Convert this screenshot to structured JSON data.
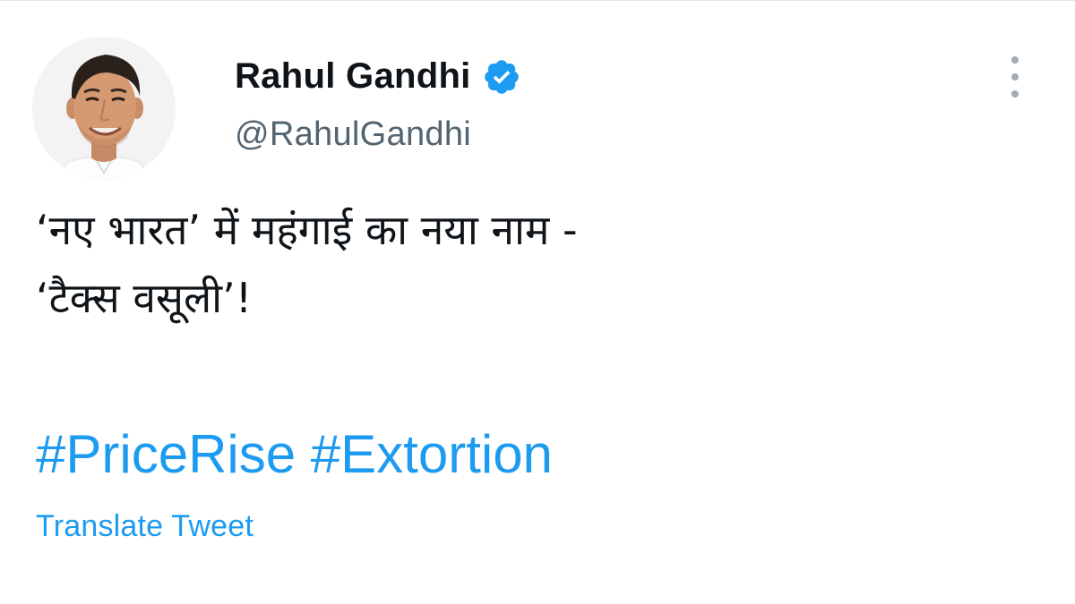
{
  "author": {
    "display_name": "Rahul Gandhi",
    "handle": "@RahulGandhi",
    "verified": true
  },
  "tweet": {
    "text_lines": [
      "‘नए भारत’ में महंगाई का नया नाम -",
      "‘टैक्स वसूली’!"
    ],
    "hashtags": [
      "#PriceRise",
      "#Extortion"
    ],
    "translate_label": "Translate Tweet"
  },
  "icons": {
    "verified": "verified-badge-icon",
    "more": "more-options-icon"
  },
  "colors": {
    "link": "#1d9bf0",
    "text": "#0f1419",
    "secondary": "#536471",
    "menu_dots": "#a3acb4"
  }
}
